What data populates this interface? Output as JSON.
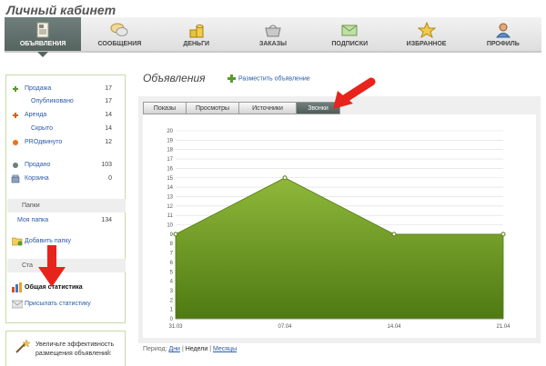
{
  "page": {
    "title": "Личный кабинет"
  },
  "tabs": [
    {
      "label": "ОБЪЯВЛЕНИЯ",
      "icon": "ads-icon",
      "active": true
    },
    {
      "label": "СООБЩЕНИЯ",
      "icon": "chat-icon",
      "active": false
    },
    {
      "label": "ДЕНЬГИ",
      "icon": "coins-icon",
      "active": false
    },
    {
      "label": "ЗАКАЗЫ",
      "icon": "basket-icon",
      "active": false
    },
    {
      "label": "ПОДПИСКИ",
      "icon": "envelope-icon",
      "active": false
    },
    {
      "label": "ИЗБРАННОЕ",
      "icon": "star-icon",
      "active": false
    },
    {
      "label": "ПРОФИЛЬ",
      "icon": "user-icon",
      "active": false
    }
  ],
  "sidebar": {
    "items": [
      {
        "label": "Продажа",
        "count": "17",
        "icon": "plus-icon"
      },
      {
        "label": "Опубликовано",
        "count": "17"
      },
      {
        "label": "Аренда",
        "count": "14",
        "icon": "plus-icon"
      },
      {
        "label": "Скрыто",
        "count": "14"
      },
      {
        "label": "PROдвинуто",
        "count": "12",
        "icon": "pro-icon"
      },
      {
        "label": "Продано",
        "count": "103",
        "icon": "sold-icon"
      },
      {
        "label": "Корзина",
        "count": "0",
        "icon": "trash-icon"
      }
    ],
    "folders_header": "Папки",
    "folder": {
      "label": "Моя папка",
      "count": "134"
    },
    "add_folder": "Добавить папку",
    "stats_header": "Ста",
    "general_stats": "Общая статистика",
    "send_stats": "Присылать статистику"
  },
  "promo": {
    "text": "Увеличьте эффективность размещения объявлений:"
  },
  "main": {
    "title": "Объявления",
    "post_link": "Разместить объявление",
    "stat_tabs": [
      "Показы",
      "Просмотры",
      "Источники",
      "Звонки"
    ],
    "active_stat_tab": 3,
    "period_label": "Период:",
    "periods": [
      "Дни",
      "Недели",
      "Месяцы"
    ],
    "period_separator": "|"
  },
  "chart_data": {
    "type": "area",
    "x": [
      "31.03",
      "07.04",
      "14.04",
      "21.04"
    ],
    "values": [
      9,
      15,
      9,
      9
    ],
    "ylim": [
      0,
      20
    ],
    "yticks": [
      0,
      1,
      2,
      3,
      4,
      5,
      6,
      7,
      8,
      9,
      10,
      11,
      12,
      13,
      14,
      15,
      16,
      17,
      18,
      19,
      20
    ],
    "grid": true,
    "fill_color": "#6e9a2c",
    "fill_top": "#8fb83a",
    "fill_bottom": "#4f7a12"
  },
  "colors": {
    "accent": "#5e6e69",
    "link": "#2a5aa8",
    "arrow": "#e8231c",
    "sidebar_border": "#c8d9a5"
  }
}
